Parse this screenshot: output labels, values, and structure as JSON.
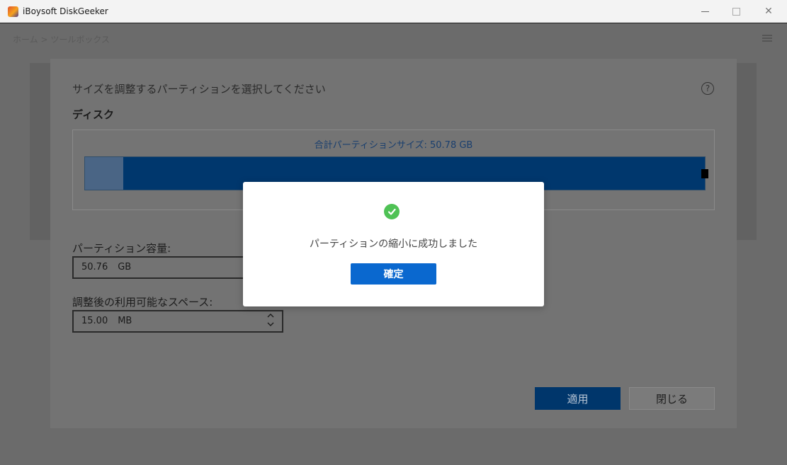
{
  "window": {
    "title": "iBoysoft DiskGeeker",
    "minimize_label": "",
    "maximize_label": "",
    "close_label": "✕"
  },
  "app": {
    "breadcrumb": "ホーム > ツールボックス"
  },
  "panel": {
    "heading": "サイズを調整するパーティションを選択してください",
    "help_label": "?",
    "disk_label": "ディスク",
    "total_size": "合計パーティションサイズ: 50.78 GB",
    "partition_used_fraction": 0.0615,
    "capacity_label": "パーティション容量:",
    "capacity_value": "50.76",
    "capacity_unit": "GB",
    "free_label": "調整後の利用可能なスペース:",
    "free_value": "15.00",
    "free_unit": "MB",
    "stepper_up": "^",
    "stepper_down": "v",
    "apply_label": "適用",
    "close_label": "閉じる"
  },
  "modal": {
    "message": "パーティションの縮小に成功しました",
    "ok_label": "確定"
  },
  "colors": {
    "accent": "#0a68cf",
    "success": "#4fc255",
    "bar_fill": "#00376d"
  }
}
